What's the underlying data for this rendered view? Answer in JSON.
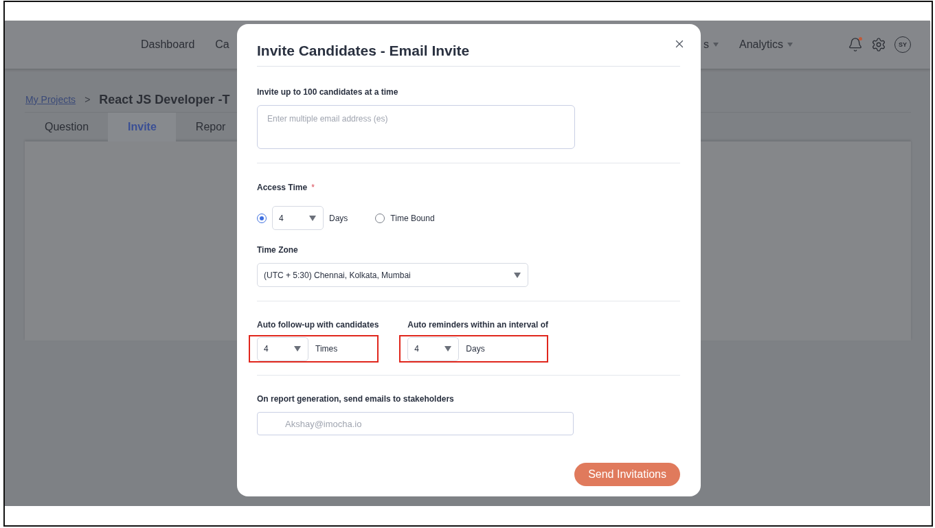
{
  "nav": {
    "items": [
      {
        "label": "Dashboard",
        "dropdown": false
      },
      {
        "label": "Ca",
        "dropdown": false
      }
    ],
    "right_items": [
      {
        "label": "s",
        "dropdown": true
      },
      {
        "label": "Analytics",
        "dropdown": true
      }
    ],
    "notifications": true,
    "avatar": "SY"
  },
  "breadcrumb": {
    "link": "My Projects",
    "separator": ">",
    "title": "React JS  Developer -T"
  },
  "tabs": [
    {
      "label": "Question",
      "selected": false
    },
    {
      "label": "Invite",
      "selected": true
    },
    {
      "label": "Repor",
      "selected": false
    }
  ],
  "modal": {
    "title": "Invite Candidates - Email Invite",
    "invite": {
      "label": "Invite up to 100 candidates at a time",
      "placeholder": "Enter multiple email address (es)"
    },
    "access_time": {
      "label": "Access Time",
      "required_mark": "*",
      "options": [
        {
          "kind": "select",
          "selected": true,
          "value": "4",
          "unit": "Days"
        },
        {
          "kind": "plain",
          "selected": false,
          "label": "Time Bound"
        }
      ]
    },
    "time_zone": {
      "label": "Time Zone",
      "value": "(UTC + 5:30) Chennai, Kolkata, Mumbai"
    },
    "follow_ups": [
      {
        "label": "Auto follow-up with candidates",
        "value": "4",
        "unit": "Times",
        "highlighted": true
      },
      {
        "label": "Auto reminders within an interval of",
        "value": "4",
        "unit": "Days",
        "highlighted": true
      }
    ],
    "stakeholders": {
      "label": "On report generation, send emails to stakeholders",
      "placeholder": "Akshay@imocha.io"
    },
    "submit": "Send Invitations"
  }
}
